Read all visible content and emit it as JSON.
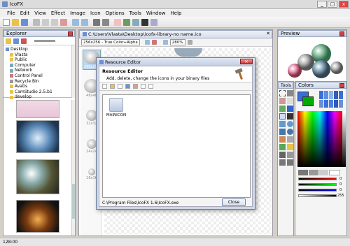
{
  "app": {
    "title": "IcoFX"
  },
  "window_controls": [
    "_",
    "□",
    "x"
  ],
  "menu": [
    "File",
    "Edit",
    "View",
    "Effect",
    "Image",
    "Icon",
    "Options",
    "Tools",
    "Window",
    "Help"
  ],
  "explorer": {
    "title": "Explorer",
    "tree": [
      "Desktop",
      "Vlasta",
      "Public",
      "Computer",
      "Network",
      "Control Panel",
      "Recycle Bin",
      "Avatis",
      "CamStudio 2.5.b1",
      "develop"
    ]
  },
  "document": {
    "path": "C:\\Users\\Vlasta\\Desktop\\icofx-library-no name.ico",
    "format": "256x256 - True Color+Alpha",
    "zoom": "280%"
  },
  "sizes": [
    {
      "label": "256x256"
    },
    {
      "label": "48x48"
    },
    {
      "label": "32x32"
    },
    {
      "label": "24x24"
    },
    {
      "label": "16x16"
    }
  ],
  "preview": {
    "title": "Preview"
  },
  "tools": {
    "title": "Tools"
  },
  "colors": {
    "title": "Colors",
    "slider_values": [
      "0",
      "0",
      "0",
      "255"
    ]
  },
  "dialog": {
    "title": "Resource Editor",
    "header_title": "Resource Editor",
    "header_desc": "Add, delete, change the icons in your binary files",
    "item_label": "MAINICON",
    "path": "C:\\Program Files\\IcoFX 1.6\\IcoFX.exe",
    "close_label": "Close"
  },
  "status": {
    "zoom": "128:00"
  },
  "accent": "#3b6fd8"
}
